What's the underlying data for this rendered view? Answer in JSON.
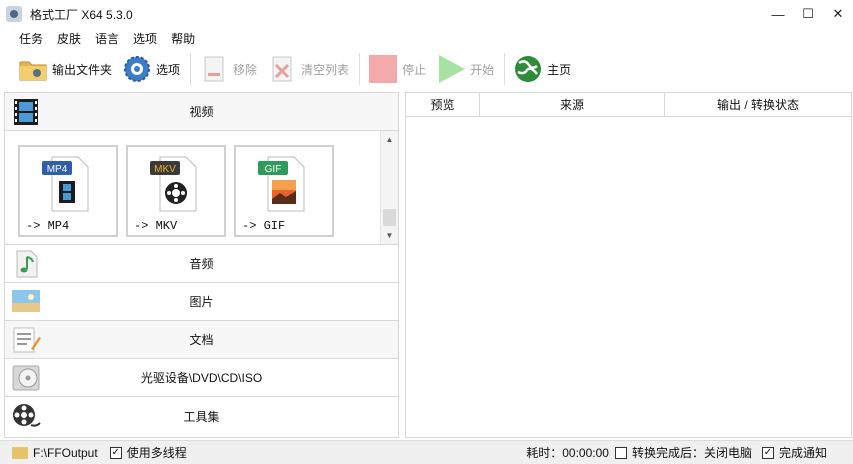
{
  "window": {
    "title": "格式工厂 X64 5.3.0",
    "minimize": "—",
    "maximize": "☐",
    "close": "✕"
  },
  "menu": [
    "任务",
    "皮肤",
    "语言",
    "选项",
    "帮助"
  ],
  "toolbar": {
    "output_folder": "输出文件夹",
    "options": "选项",
    "remove": "移除",
    "clear_list": "清空列表",
    "stop": "停止",
    "start": "开始",
    "home": "主页"
  },
  "categories": {
    "video": "视频",
    "audio": "音频",
    "image": "图片",
    "document": "文档",
    "optical": "光驱设备\\DVD\\CD\\ISO",
    "tools": "工具集"
  },
  "formats": [
    {
      "badge": "MP4",
      "label": "-> MP4",
      "color": "#2f5fa8"
    },
    {
      "badge": "MKV",
      "label": "-> MKV",
      "color": "#3a3a3a"
    },
    {
      "badge": "GIF",
      "label": "-> GIF",
      "color": "#2e9b5a"
    }
  ],
  "task_table": {
    "columns": [
      "预览",
      "来源",
      "输出 / 转换状态"
    ]
  },
  "status": {
    "output_path": "F:\\FFOutput",
    "multithread": "使用多线程",
    "multithread_checked": "✓",
    "elapsed": "耗时：00:00:00",
    "after_done": "转换完成后：关闭电脑",
    "after_done_checked": "",
    "notify": "完成通知",
    "notify_checked": "✓"
  },
  "scrollbar": {
    "up": "▲",
    "down": "▼"
  }
}
